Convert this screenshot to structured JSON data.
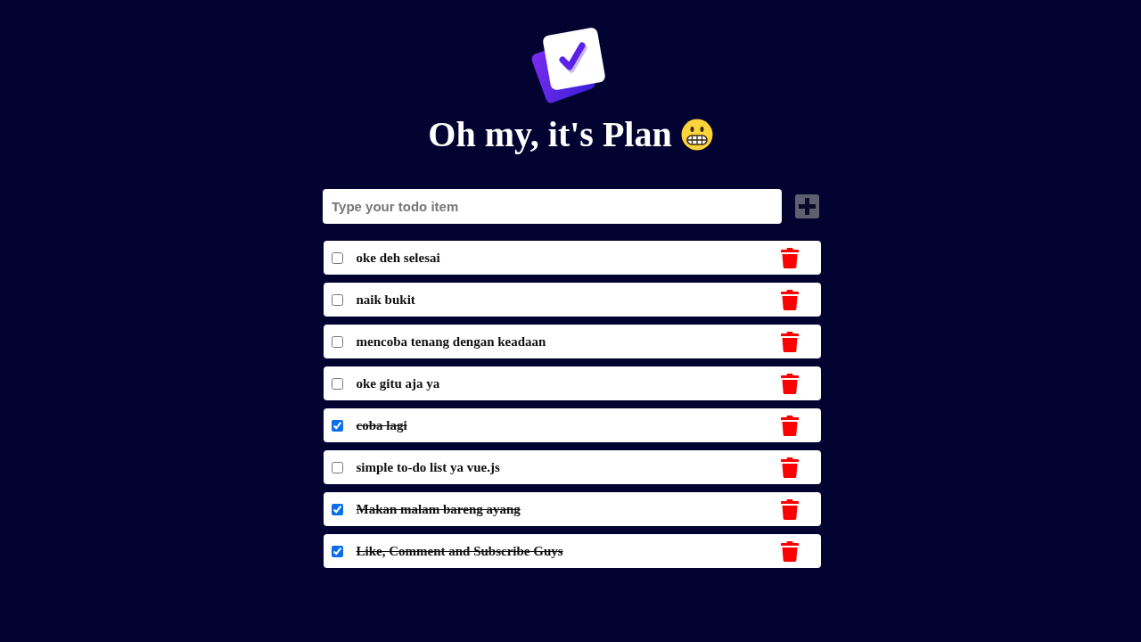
{
  "header": {
    "title": "Oh my, it's Plan"
  },
  "new_todo": {
    "placeholder": "Type your todo item"
  },
  "todos": [
    {
      "text": "oke deh selesai",
      "done": false
    },
    {
      "text": "naik bukit",
      "done": false
    },
    {
      "text": "mencoba tenang dengan keadaan",
      "done": false
    },
    {
      "text": "oke gitu aja ya",
      "done": false
    },
    {
      "text": "coba lagi",
      "done": true
    },
    {
      "text": "simple to-do list ya vue.js",
      "done": false
    },
    {
      "text": "Makan malam bareng ayang",
      "done": true
    },
    {
      "text": "Like, Comment and Subscribe Guys",
      "done": true
    }
  ]
}
